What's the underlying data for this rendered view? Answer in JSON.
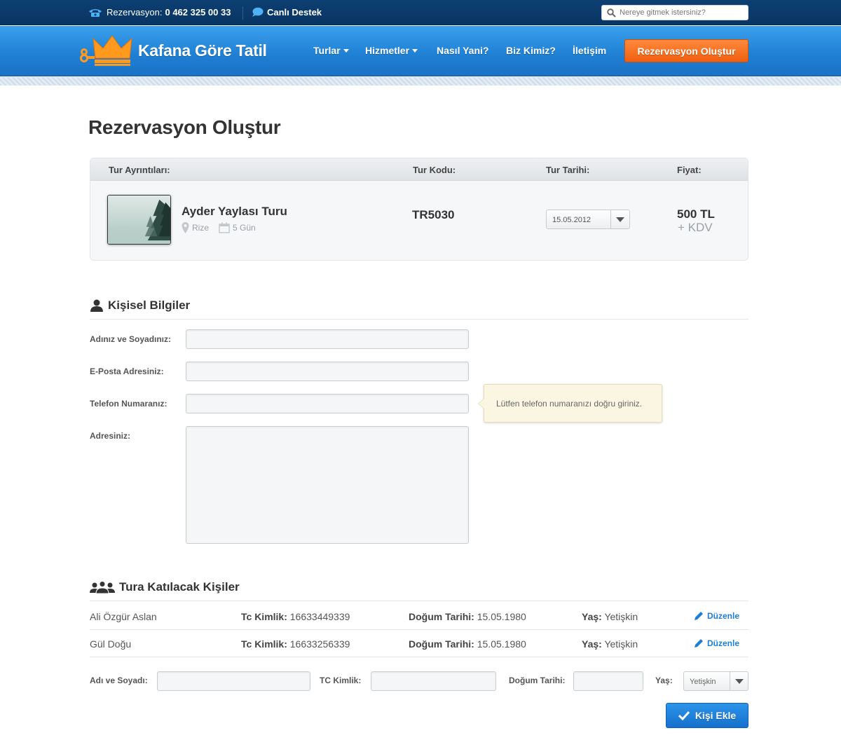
{
  "topbar": {
    "phone_label": "Rezervasyon:",
    "phone_number": "0 462 325 00 33",
    "support_label": "Canlı Destek",
    "search_placeholder": "Nereye gitmek istersiniz?"
  },
  "brand": {
    "name": "Kafana Göre Tatil"
  },
  "nav": {
    "items": [
      "Turlar",
      "Hizmetler",
      "Nasıl Yani?",
      "Biz Kimiz?",
      "İletişim"
    ],
    "cta": "Rezervasyon Oluştur"
  },
  "page": {
    "title": "Rezervasyon Oluştur"
  },
  "tour": {
    "headers": {
      "details": "Tur Ayrıntıları:",
      "code": "Tur Kodu:",
      "date": "Tur Tarihi:",
      "price": "Fiyat:"
    },
    "name": "Ayder Yaylası Turu",
    "location": "Rize",
    "duration": "5 Gün",
    "code": "TR5030",
    "date": "15.05.2012",
    "price": "500 TL",
    "vat": "+ KDV"
  },
  "personal": {
    "title": "Kişisel Bilgiler",
    "labels": {
      "name": "Adınız ve Soyadınız:",
      "email": "E-Posta Adresiniz:",
      "phone": "Telefon Numaranız:",
      "address": "Adresiniz:"
    },
    "phone_tooltip": "Lütfen telefon numaranızı doğru giriniz."
  },
  "participants": {
    "title": "Tura Katılacak Kişiler",
    "tc_label": "Tc Kimlik:",
    "dob_label": "Doğum Tarihi:",
    "age_label": "Yaş:",
    "edit_label": "Düzenle",
    "rows": [
      {
        "name": "Ali Özgür Aslan",
        "tc": "16633449339",
        "dob": "15.05.1980",
        "age": "Yetişkin"
      },
      {
        "name": "Gül Doğu",
        "tc": "16633256339",
        "dob": "15.05.1980",
        "age": "Yetişkin"
      }
    ],
    "add_form": {
      "name_label": "Adı ve Soyadı:",
      "tc_label": "TC Kimlik:",
      "dob_label": "Doğum Tarihi:",
      "age_label": "Yaş:",
      "age_value": "Yetişkin",
      "button": "Kişi Ekle"
    }
  },
  "colors": {
    "nav_blue": "#1f7fd3",
    "top_navy": "#0c3f72",
    "cta_orange": "#f26a1b",
    "link_blue": "#1d7fd4",
    "tooltip_bg": "#faf6e2"
  }
}
